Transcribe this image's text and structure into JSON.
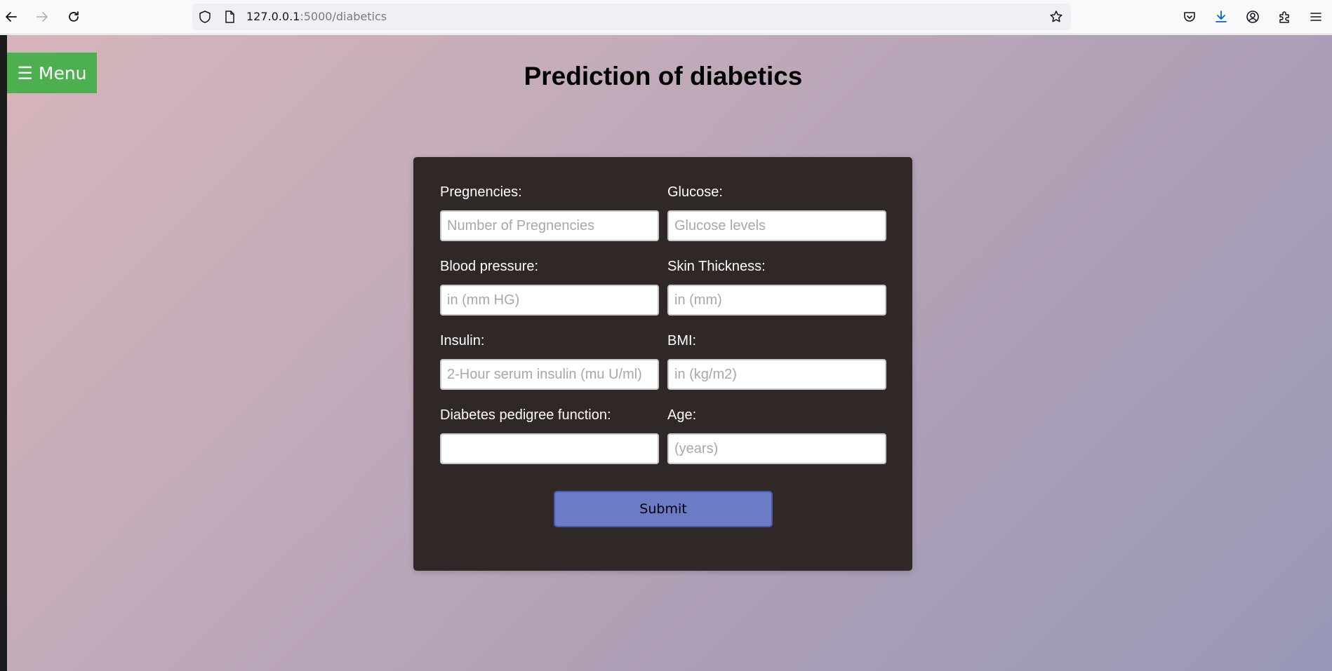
{
  "browser": {
    "url_host": "127.0.0.1",
    "url_path": ":5000/diabetics"
  },
  "page": {
    "menu_label": "Menu",
    "menu_icon": "☰",
    "title": "Prediction of diabetics"
  },
  "form": {
    "fields": [
      {
        "label": "Pregnencies:",
        "placeholder": "Number of Pregnencies",
        "value": ""
      },
      {
        "label": "Glucose:",
        "placeholder": "Glucose levels",
        "value": ""
      },
      {
        "label": "Blood pressure:",
        "placeholder": "in (mm HG)",
        "value": ""
      },
      {
        "label": "Skin Thickness:",
        "placeholder": "in (mm)",
        "value": ""
      },
      {
        "label": "Insulin:",
        "placeholder": "2-Hour serum insulin (mu U/ml)",
        "value": ""
      },
      {
        "label": "BMI:",
        "placeholder": "in (kg/m2)",
        "value": ""
      },
      {
        "label": "Diabetes pedigree function:",
        "placeholder": "",
        "value": ""
      },
      {
        "label": "Age:",
        "placeholder": "(years)",
        "value": ""
      }
    ],
    "submit_label": "Submit"
  },
  "colors": {
    "menu_button": "#4caf50",
    "card_background": "#302826",
    "submit_button": "#6b7bc6"
  }
}
